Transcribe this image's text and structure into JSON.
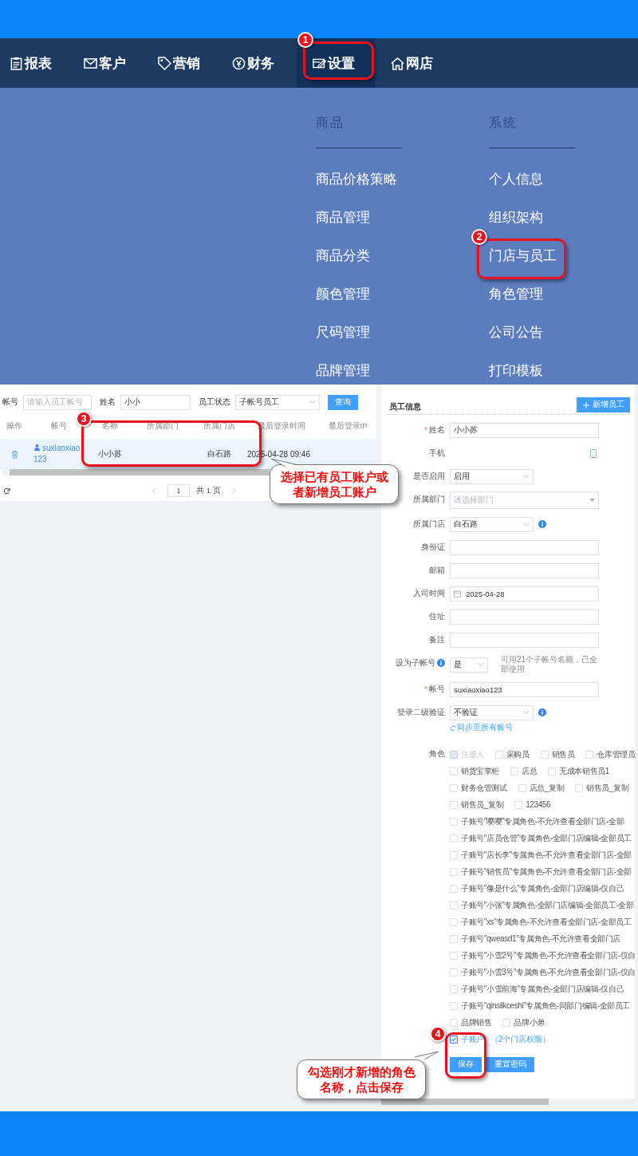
{
  "nav": [
    {
      "label": "报表",
      "selected": false
    },
    {
      "label": "客户",
      "selected": false
    },
    {
      "label": "营销",
      "selected": false
    },
    {
      "label": "财务",
      "selected": false
    },
    {
      "label": "设置",
      "selected": true
    },
    {
      "label": "网店",
      "selected": false
    }
  ],
  "menu": {
    "columns": [
      {
        "heading": "商品",
        "items": [
          "商品价格策略",
          "商品管理",
          "商品分类",
          "颜色管理",
          "尺码管理",
          "品牌管理"
        ]
      },
      {
        "heading": "系统",
        "items": [
          "个人信息",
          "组织架构",
          "门店与员工",
          "角色管理",
          "公司公告",
          "打印模板"
        ]
      }
    ]
  },
  "filters": [
    {
      "kind": "input",
      "label": "帐号",
      "placeholder": "请输入员工帐号"
    },
    {
      "kind": "input",
      "label": "姓名",
      "value": "小小"
    },
    {
      "kind": "select",
      "label": "员工状态",
      "value": "子帐号员工"
    }
  ],
  "search_button": "查询",
  "table": {
    "columns": [
      "操作",
      "帐号",
      "名称",
      "所属部门",
      "所属门店",
      "最后登录时间",
      "最后登录IP"
    ],
    "rows": [
      {
        "selected": true,
        "account": "suxiaoxiao123",
        "name": "小小苏",
        "store": "白石路",
        "last_login": "2025-04-28 09:46"
      }
    ]
  },
  "pagination": {
    "page": "1",
    "total": "共 1 页"
  },
  "panel": {
    "title": "员工信息",
    "add_button": "新增员工"
  },
  "fields": [
    {
      "kind": "input",
      "label": "姓名",
      "mark": "*",
      "value": "小小苏"
    },
    {
      "kind": "phone",
      "label": "手机"
    },
    {
      "kind": "select",
      "label": "是否启用",
      "value": "启用"
    },
    {
      "kind": "dropdown",
      "label": "所属部门",
      "placeholder": "请选择部门"
    },
    {
      "kind": "select",
      "label": "所属门店",
      "value": "白石路",
      "info": true
    },
    {
      "kind": "input",
      "label": "身份证"
    },
    {
      "kind": "input",
      "label": "邮箱"
    },
    {
      "kind": "date",
      "label": "入司时间",
      "value": "2025-04-28"
    },
    {
      "kind": "input",
      "label": "住址"
    },
    {
      "kind": "input",
      "label": "备注"
    },
    {
      "kind": "compact-select",
      "label": "设为子帐号",
      "label_info": true,
      "value": "是",
      "note": "可用21个子帐号名额，已全部使用"
    },
    {
      "kind": "input",
      "label": "帐号",
      "mark": "*",
      "value": "suxiaoxiao123"
    },
    {
      "kind": "select",
      "label": "登录二级验证",
      "value": "不验证",
      "info": true,
      "link": "同步至所有账号"
    }
  ],
  "roles": {
    "label": "角色",
    "items": [
      {
        "text": "注册人",
        "checked": false,
        "disabled": true
      },
      {
        "text": "采购员",
        "checked": false,
        "disabled": false
      },
      {
        "text": "销售员",
        "checked": false,
        "disabled": false
      },
      {
        "text": "仓库管理员",
        "checked": false,
        "disabled": false
      },
      {
        "text": "销货宝掌柜",
        "checked": false,
        "disabled": false
      },
      {
        "text": "店总",
        "checked": false,
        "disabled": false
      },
      {
        "text": "无成本销售员1",
        "checked": false,
        "disabled": false
      },
      {
        "text": "财务仓管测试",
        "checked": false,
        "disabled": false
      },
      {
        "text": "店总_复制",
        "checked": false,
        "disabled": false
      },
      {
        "text": "销售员_复制",
        "checked": false,
        "disabled": false
      },
      {
        "text": "销售员_复制",
        "checked": false,
        "disabled": false
      },
      {
        "text": "123456",
        "checked": false,
        "disabled": false
      },
      {
        "text": "子账号\"嘤嘤\"专属角色-不允许查看全部门店-全部",
        "checked": false,
        "disabled": false
      },
      {
        "text": "子账号\"店员仓管\"专属角色-全部门店编辑-全部员工",
        "checked": false,
        "disabled": false
      },
      {
        "text": "子账号\"店长李\"专属角色-不允许查看全部门店-全部",
        "checked": false,
        "disabled": false
      },
      {
        "text": "子账号\"销售员\"专属角色-不允许查看全部门店-全部",
        "checked": false,
        "disabled": false
      },
      {
        "text": "子账号\"像是什么\"专属角色-全部门店编辑-仅自己",
        "checked": false,
        "disabled": false
      },
      {
        "text": "子账号\"小张\"专属角色-全部门店编辑-全部员工-全部",
        "checked": false,
        "disabled": false
      },
      {
        "text": "子账号\"xs\"专属角色-不允许查看全部门店-全部员工",
        "checked": false,
        "disabled": false
      },
      {
        "text": "子账号\"qweasd1\"专属角色-不允许查看全部门店",
        "checked": false,
        "disabled": false
      },
      {
        "text": "子账号\"小雪2号\"专属角色-不允许查看全部门店-仅自",
        "checked": false,
        "disabled": false
      },
      {
        "text": "子账号\"小雪3号\"专属角色-不允许查看全部门店-仅自",
        "checked": false,
        "disabled": false
      },
      {
        "text": "子账号\"小雪前海\"专属角色-全部门店编辑-仅自己",
        "checked": false,
        "disabled": false
      },
      {
        "text": "子账号\"qinsilkceshi\"专属角色-同部门编辑-全部员工",
        "checked": false,
        "disabled": false
      },
      {
        "text": "品牌销售",
        "checked": false,
        "disabled": false
      },
      {
        "text": "品牌小弟",
        "checked": false,
        "disabled": false
      },
      {
        "text": "子账户",
        "checked": true,
        "disabled": false,
        "note": "（2个门店权限）"
      }
    ]
  },
  "buttons": [
    "保存",
    "重置密码"
  ],
  "annotations": [
    {
      "number": "1"
    },
    {
      "number": "2"
    },
    {
      "number": "3"
    },
    {
      "number": "4"
    }
  ],
  "callouts": [
    "选择已有员工账户或者新增员工账户",
    "勾选刚才新增的角色名称，点击保存"
  ]
}
